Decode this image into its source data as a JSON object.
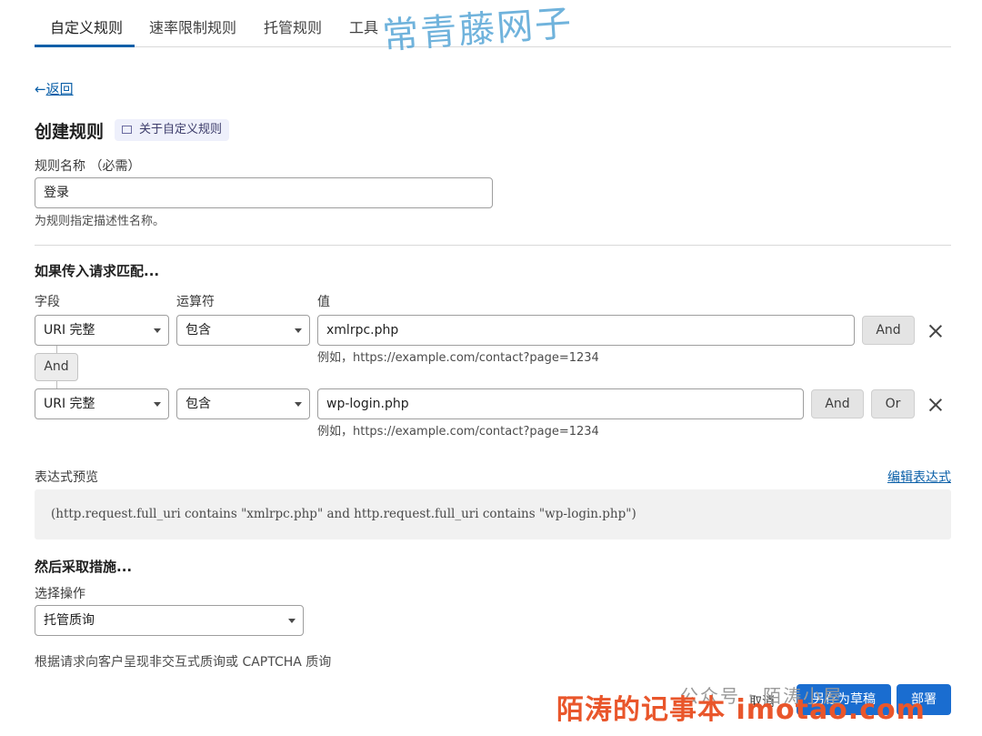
{
  "tabs": [
    {
      "label": "自定义规则",
      "active": true
    },
    {
      "label": "速率限制规则",
      "active": false
    },
    {
      "label": "托管规则",
      "active": false
    },
    {
      "label": "工具",
      "active": false
    }
  ],
  "watermark_top": "常青藤网子",
  "back": {
    "arrow": "←",
    "label": "返回"
  },
  "page": {
    "title": "创建规则",
    "doc_link": "关于自定义规则"
  },
  "rule_name": {
    "label": "规则名称 （必需）",
    "value": "登录",
    "help": "为规则指定描述性名称。"
  },
  "match": {
    "heading": "如果传入请求匹配...",
    "col_field": "字段",
    "col_operator": "运算符",
    "col_value": "值",
    "connector": "And",
    "example": "例如，https://example.com/contact?page=1234",
    "rows": [
      {
        "field": "URI 完整",
        "operator": "包含",
        "value": "xmlrpc.php",
        "and_label": "And"
      },
      {
        "field": "URI 完整",
        "operator": "包含",
        "value": "wp-login.php",
        "and_label": "And",
        "or_label": "Or"
      }
    ]
  },
  "expression": {
    "label": "表达式预览",
    "edit_link": "编辑表达式",
    "text": "(http.request.full_uri contains \"xmlrpc.php\" and http.request.full_uri contains \"wp-login.php\")"
  },
  "action": {
    "heading": "然后采取措施...",
    "select_label": "选择操作",
    "value": "托管质询",
    "help": "根据请求向客户呈现非交互式质询或 CAPTCHA 质询"
  },
  "footer": {
    "cancel": "取消",
    "save_draft": "另存为草稿",
    "deploy": "部署"
  },
  "watermark_follow": "公众号 · 陌涛小屋",
  "watermark_bottom": "陌涛的记事本 imotao.com",
  "colors": {
    "accent": "#0a5fa8",
    "primary_button": "#1a6dd0",
    "watermark_orange": "#e9562b",
    "watermark_blue": "#58a6d6"
  }
}
